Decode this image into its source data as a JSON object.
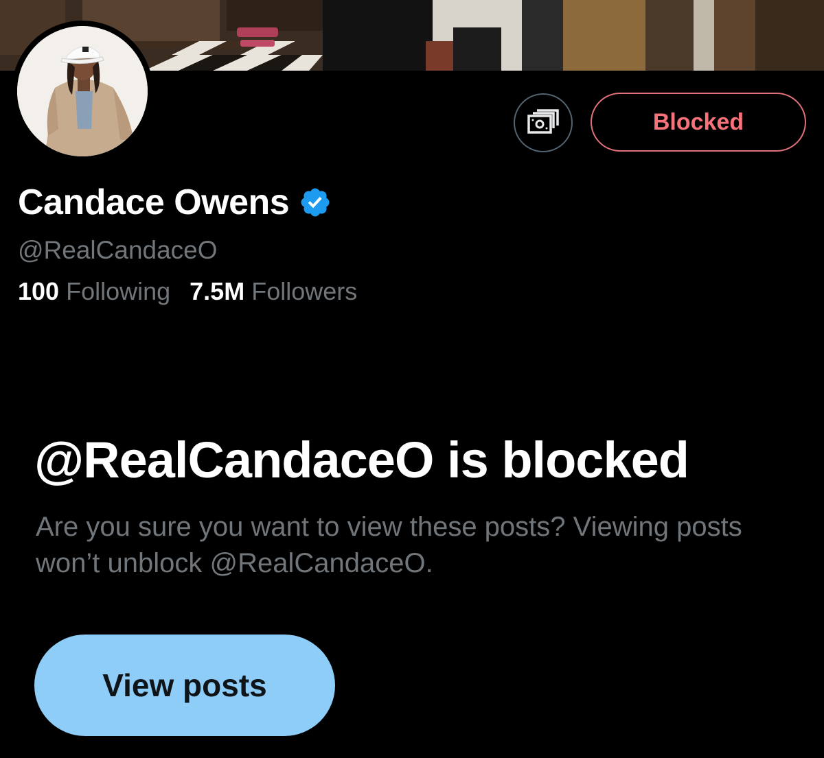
{
  "profile": {
    "display_name": "Candace Owens",
    "handle": "@RealCandaceO",
    "following_count": "100",
    "following_label": "Following",
    "followers_count": "7.5M",
    "followers_label": "Followers"
  },
  "actions": {
    "tip_icon": "money-icon",
    "blocked_label": "Blocked"
  },
  "notice": {
    "title": "@RealCandaceO is blocked",
    "description": "Are you sure you want to view these posts? Viewing posts won’t unblock @RealCandaceO.",
    "button_label": "View posts"
  },
  "colors": {
    "background": "#000000",
    "secondary_text": "#71767b",
    "blocked_red": "#f7727b",
    "verified_blue": "#1d9bf0",
    "view_posts_bg": "#8ecdf8"
  }
}
